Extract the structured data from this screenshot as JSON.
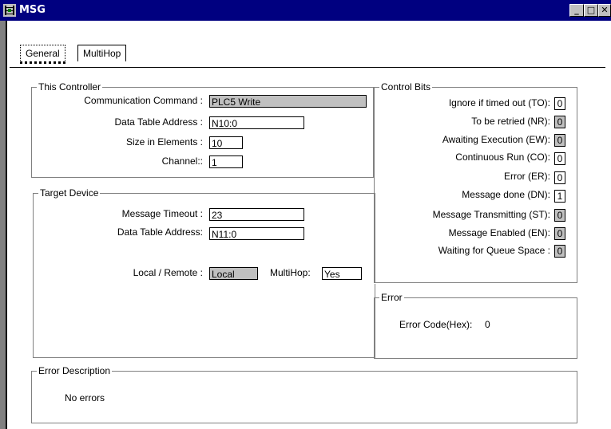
{
  "window": {
    "title": "MSG",
    "minimize": "_",
    "maximize": "□",
    "close": "✕"
  },
  "tabs": [
    {
      "label": "General"
    },
    {
      "label": "MultiHop"
    }
  ],
  "this_controller": {
    "label": "This Controller",
    "comm_label": "Communication Command :",
    "comm_value": "PLC5 Write",
    "dta_label": "Data Table Address :",
    "dta_value": "N10:0",
    "size_label": "Size in Elements :",
    "size_value": "10",
    "channel_label": "Channel::",
    "channel_value": "1"
  },
  "target_device": {
    "label": "Target Device",
    "timeout_label": "Message Timeout :",
    "timeout_value": "23",
    "dta_label": "Data Table Address:",
    "dta_value": "N11:0",
    "local_remote_label": "Local / Remote :",
    "local_remote_value": "Local",
    "multihop_label": "MultiHop:",
    "multihop_value": "Yes"
  },
  "control_bits": {
    "label": "Control Bits",
    "items": [
      {
        "label": "Ignore if timed out (TO):",
        "value": "0"
      },
      {
        "label": "To be retried (NR):",
        "value": "0"
      },
      {
        "label": "Awaiting Execution (EW):",
        "value": "0"
      },
      {
        "label": "Continuous Run (CO):",
        "value": "0"
      },
      {
        "label": "Error (ER):",
        "value": "0"
      },
      {
        "label": "Message done (DN):",
        "value": "1"
      },
      {
        "label": "Message Transmitting (ST):",
        "value": "0"
      },
      {
        "label": "Message Enabled (EN):",
        "value": "0"
      },
      {
        "label": "Waiting for Queue Space :",
        "value": "0"
      }
    ]
  },
  "error": {
    "label": "Error",
    "code_label": "Error Code(Hex):",
    "code_value": "0"
  },
  "error_description": {
    "label": "Error Description",
    "text": "No errors"
  }
}
